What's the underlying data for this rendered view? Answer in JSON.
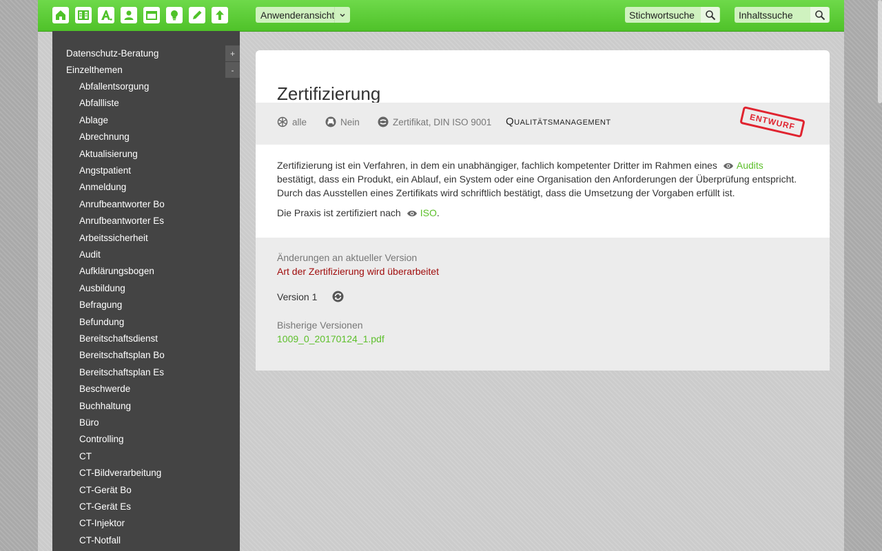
{
  "toolbar": {
    "icons": [
      "home-icon",
      "book-icon",
      "font-icon",
      "user-icon",
      "folder-icon",
      "lightbulb-icon",
      "pencil-icon",
      "upload-icon"
    ],
    "view_select": "Anwenderansicht",
    "keyword_search": {
      "placeholder": "Stichwortsuche"
    },
    "content_search": {
      "placeholder": "Inhaltssuche"
    }
  },
  "sidebar": {
    "expand_label": "+",
    "collapse_label": "-",
    "root_items": [
      "Datenschutz-Beratung",
      "Einzelthemen"
    ],
    "items": [
      "Abfallentsorgung",
      "Abfallliste",
      "Ablage",
      "Abrechnung",
      "Aktualisierung",
      "Angstpatient",
      "Anmeldung",
      "Anrufbeantworter Bo",
      "Anrufbeantworter Es",
      "Arbeitssicherheit",
      "Audit",
      "Aufklärungsbogen",
      "Ausbildung",
      "Befragung",
      "Befundung",
      "Bereitschaftsdienst",
      "Bereitschaftsplan Bo",
      "Bereitschaftsplan Es",
      "Beschwerde",
      "Buchhaltung",
      "Büro",
      "Controlling",
      "CT",
      "CT-Bildverarbeitung",
      "CT-Gerät Bo",
      "CT-Gerät Es",
      "CT-Injektor",
      "CT-Notfall"
    ]
  },
  "article": {
    "title": "Zertifizierung",
    "meta": {
      "audience": "alle",
      "print": "Nein",
      "tags": "Zertifikat, DIN ISO 9001",
      "category": "Qualitätsmanagement"
    },
    "stamp": "ENTWURF",
    "description_part1": "Zertifizierung ist ein Verfahren, in dem ein unabhängiger, fachlich kompetenter Dritter im Rahmen eines",
    "description_link1": "Audits",
    "description_part2": "bestätigt, dass ein Produkt, ein Ablauf, ein System oder eine Organisation den Anforderungen der Überprüfung entspricht. Durch das Ausstellen eines Zertifikats wird schriftlich bestätigt, dass die Umsetzung der Vorgaben erfüllt ist.",
    "praxis_text": "Die Praxis ist zertifiziert nach",
    "praxis_link": "ISO",
    "praxis_end": ".",
    "changes_label": "Änderungen an aktueller Version",
    "changes_note": "Art der Zertifizierung wird überarbeitet",
    "version_label": "Version 1",
    "previous_label": "Bisherige Versionen",
    "previous_file": "1009_0_20170124_1.pdf"
  },
  "colors": {
    "accent": "#5cbf2a",
    "topbar": "#5ccf35",
    "sidebar": "#444444",
    "stamp": "#e0232f",
    "change_note": "#a00d0d"
  }
}
